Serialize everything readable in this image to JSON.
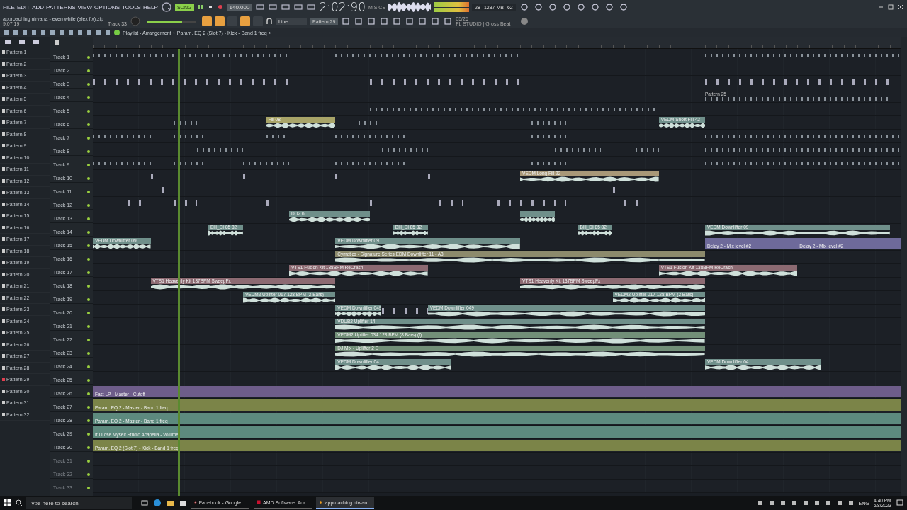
{
  "menu": [
    "FILE",
    "EDIT",
    "ADD",
    "PATTERNS",
    "VIEW",
    "OPTIONS",
    "TOOLS",
    "HELP"
  ],
  "transport": {
    "song_mode": {
      "label": "SONG",
      "on": true
    },
    "tempo": "140.000",
    "time": "2:02:90",
    "time_format": "M:S:CS"
  },
  "stats": {
    "cpu": "28",
    "memory": "1287 MB",
    "polyphony": "62"
  },
  "project": {
    "name": "approaching nirvana - even while (alex fix).zip",
    "duration": "9:07:19",
    "focus": "Track 33",
    "volume": {
      "level": 0.72
    }
  },
  "snap_buttons": [
    {
      "on": true
    },
    {
      "on": true
    },
    {
      "on": false
    },
    {
      "on": true
    },
    {
      "on": false
    }
  ],
  "snap": "Line",
  "pattern_selector": "Pattern 29",
  "news": {
    "date": "05/26",
    "text": "FL STUDIO | Gross Beat"
  },
  "breadcrumb": [
    {
      "text": "Playlist - Arrangement"
    },
    {
      "text": "›"
    },
    {
      "text": "Param. EQ 2 (Slot 7) - Kick - Band 1 freq"
    },
    {
      "text": "›"
    }
  ],
  "patterns": [
    {
      "name": "Pattern 1",
      "selected": false
    },
    {
      "name": "Pattern 2",
      "selected": false
    },
    {
      "name": "Pattern 3",
      "selected": false
    },
    {
      "name": "Pattern 4",
      "selected": false
    },
    {
      "name": "Pattern 5",
      "selected": false
    },
    {
      "name": "Pattern 6",
      "selected": false
    },
    {
      "name": "Pattern 7",
      "selected": false
    },
    {
      "name": "Pattern 8",
      "selected": false
    },
    {
      "name": "Pattern 9",
      "selected": false
    },
    {
      "name": "Pattern 10",
      "selected": false
    },
    {
      "name": "Pattern 11",
      "selected": false
    },
    {
      "name": "Pattern 12",
      "selected": false
    },
    {
      "name": "Pattern 13",
      "selected": false
    },
    {
      "name": "Pattern 14",
      "selected": false
    },
    {
      "name": "Pattern 15",
      "selected": false
    },
    {
      "name": "Pattern 16",
      "selected": false
    },
    {
      "name": "Pattern 17",
      "selected": false
    },
    {
      "name": "Pattern 18",
      "selected": false
    },
    {
      "name": "Pattern 19",
      "selected": false
    },
    {
      "name": "Pattern 20",
      "selected": false
    },
    {
      "name": "Pattern 21",
      "selected": false
    },
    {
      "name": "Pattern 22",
      "selected": false
    },
    {
      "name": "Pattern 23",
      "selected": false
    },
    {
      "name": "Pattern 24",
      "selected": false
    },
    {
      "name": "Pattern 25",
      "selected": false
    },
    {
      "name": "Pattern 26",
      "selected": false
    },
    {
      "name": "Pattern 27",
      "selected": false
    },
    {
      "name": "Pattern 28",
      "selected": false
    },
    {
      "name": "Pattern 29",
      "selected": true
    },
    {
      "name": "Pattern 30",
      "selected": false
    },
    {
      "name": "Pattern 31",
      "selected": false
    },
    {
      "name": "Pattern 32",
      "selected": false
    }
  ],
  "playhead": {
    "level": 0.105
  },
  "tracks": [
    {
      "name": "Track 1",
      "empty": false,
      "clips": [
        {
          "kind": "pattern"
        },
        {
          "kind": "pattern"
        },
        {
          "kind": "pattern"
        }
      ]
    },
    {
      "name": "Track 2",
      "empty": false
    },
    {
      "name": "Track 3",
      "empty": false,
      "clips": [
        {
          "kind": "hits"
        },
        {
          "kind": "hits"
        },
        {
          "kind": "hits"
        }
      ]
    },
    {
      "name": "Track 4",
      "empty": false,
      "clips": [
        {
          "kind": "pattern",
          "label": "Pattern 25"
        }
      ]
    },
    {
      "name": "Track 5",
      "empty": false,
      "clips": [
        {
          "kind": "pattern"
        }
      ]
    },
    {
      "name": "Track 6",
      "empty": false,
      "clips": [
        {
          "kind": "pattern"
        },
        {
          "kind": "audio",
          "label": "Fill 08",
          "color": "#a8a468"
        },
        {
          "kind": "pattern"
        },
        {
          "kind": "pattern"
        },
        {
          "kind": "audio",
          "label": "VEDM Short Fill 42",
          "color": "#6f8f8a"
        }
      ]
    },
    {
      "name": "Track 7",
      "empty": false,
      "clips": [
        {
          "kind": "pattern"
        },
        {
          "kind": "pattern"
        },
        {
          "kind": "pattern"
        },
        {
          "kind": "pattern"
        },
        {
          "kind": "pattern"
        },
        {
          "kind": "pattern"
        }
      ]
    },
    {
      "name": "Track 8",
      "empty": false,
      "clips": [
        {
          "kind": "pattern"
        },
        {
          "kind": "pattern"
        },
        {
          "kind": "pattern"
        },
        {
          "kind": "pattern"
        },
        {
          "kind": "pattern"
        }
      ]
    },
    {
      "name": "Track 9",
      "empty": false,
      "clips": [
        {
          "kind": "pattern"
        },
        {
          "kind": "pattern"
        },
        {
          "kind": "pattern"
        },
        {
          "kind": "pattern"
        },
        {
          "kind": "pattern"
        },
        {
          "kind": "pattern"
        }
      ]
    },
    {
      "name": "Track 10",
      "empty": false,
      "clips": [
        {
          "kind": "hits"
        },
        {
          "kind": "hits"
        },
        {
          "kind": "hits"
        },
        {
          "kind": "hits"
        },
        {
          "kind": "audio",
          "label": "VEDM Long Fill 22",
          "color": "#a89878"
        }
      ]
    },
    {
      "name": "Track 11",
      "empty": false,
      "clips": [
        {
          "kind": "hits"
        },
        {
          "kind": "hits"
        }
      ]
    },
    {
      "name": "Track 12",
      "empty": false,
      "clips": [
        {
          "kind": "hits"
        },
        {
          "kind": "hits"
        },
        {
          "kind": "hits"
        },
        {
          "kind": "hits"
        },
        {
          "kind": "hits"
        },
        {
          "kind": "hits"
        },
        {
          "kind": "hits"
        }
      ]
    },
    {
      "name": "Track 13",
      "empty": false,
      "clips": [
        {
          "kind": "audio",
          "label": "DD2 6",
          "color": "#6f8f8a"
        },
        {
          "kind": "audio",
          "color": "#6f8f8a"
        }
      ]
    },
    {
      "name": "Track 14",
      "empty": false,
      "clips": [
        {
          "kind": "audio",
          "label": "BH_DI 85 82",
          "color": "#6f8f8a"
        },
        {
          "kind": "audio",
          "label": "BH_DI 85 82",
          "color": "#6f8f8a"
        },
        {
          "kind": "audio",
          "label": "BH_DI 85 82",
          "color": "#6f8f8a"
        },
        {
          "kind": "audio",
          "label": "VEDM Downlifter 09",
          "color": "#6f8f8a"
        }
      ]
    },
    {
      "name": "Track 15",
      "empty": false,
      "clips": [
        {
          "kind": "audio",
          "label": "VEDM Downlifter 09",
          "color": "#6f8f8a"
        },
        {
          "kind": "audio",
          "label": "VEDM Downlifter 09",
          "color": "#6f8f8a"
        },
        {
          "kind": "automation",
          "label": "Delay 2 - Mix level #2",
          "color": "#6e6a9a"
        },
        {
          "kind": "automation",
          "label": "Delay 2 - Mix level #2",
          "color": "#6e6a9a"
        }
      ]
    },
    {
      "name": "Track 16",
      "empty": false,
      "clips": [
        {
          "kind": "audio",
          "label": "Cymatics - Signature Series EDM Downlifter 11 - A8",
          "color": "#8c8a6c"
        }
      ]
    },
    {
      "name": "Track 17",
      "empty": false,
      "clips": [
        {
          "kind": "audio",
          "label": "VTS1 Fusion Kit 138BPM ReCrash",
          "color": "#8c6a72"
        },
        {
          "kind": "audio",
          "label": "VTS1 Fusion Kit 138BPM ReCrash",
          "color": "#8c6a72"
        }
      ]
    },
    {
      "name": "Track 18",
      "empty": false,
      "clips": [
        {
          "kind": "audio",
          "label": "VTS1 Heavenly Kit 137BPM SweepFx",
          "color": "#8c6a72"
        },
        {
          "kind": "audio",
          "label": "VTS1 Heavenly Kit 137BPM SweepFx",
          "color": "#8c6a72"
        }
      ]
    },
    {
      "name": "Track 19",
      "empty": false,
      "clips": [
        {
          "kind": "audio",
          "label": "VEDM2 Uplifter 017 128 BPM (2 Bars)",
          "color": "#6f8f8a"
        },
        {
          "kind": "audio",
          "label": "VEDM2 Uplifter 017 128 BPM (2 Bars)",
          "color": "#6f8f8a"
        }
      ]
    },
    {
      "name": "Track 20",
      "empty": false,
      "clips": [
        {
          "kind": "audio",
          "label": "VEDM Downlifter 049",
          "color": "#6f8f8a"
        },
        {
          "kind": "hits"
        },
        {
          "kind": "audio",
          "label": "VEDM Downlifter 049",
          "color": "#6f8f8a"
        }
      ]
    },
    {
      "name": "Track 21",
      "empty": false,
      "clips": [
        {
          "kind": "audio",
          "label": "VDUB2 Uplifter 14",
          "color": "#6f8f8a"
        }
      ]
    },
    {
      "name": "Track 22",
      "empty": false,
      "clips": [
        {
          "kind": "audio",
          "label": "VEDM2 Uplifter 034 128 BPM (8 Bars) (f)",
          "color": "#728f78"
        }
      ]
    },
    {
      "name": "Track 23",
      "empty": false,
      "clips": [
        {
          "kind": "audio",
          "label": "DJ Mix - Uplifter 2 E",
          "color": "#728f78"
        }
      ]
    },
    {
      "name": "Track 24",
      "empty": false,
      "clips": [
        {
          "kind": "audio",
          "label": "VEDM Downlifter 04",
          "color": "#6f8f8a"
        },
        {
          "kind": "audio",
          "label": "VEDM Downlifter 04",
          "color": "#6f8f8a"
        }
      ]
    },
    {
      "name": "Track 25",
      "empty": false
    },
    {
      "name": "Track 26",
      "empty": false,
      "clips": [
        {
          "kind": "automation",
          "label": "Fast LP - Master - Cutoff",
          "color": "#6e5d8a"
        }
      ]
    },
    {
      "name": "Track 27",
      "empty": false,
      "clips": [
        {
          "kind": "automation",
          "label": "Param. EQ 2 - Master - Band 1 freq",
          "color": "#7b8448"
        }
      ]
    },
    {
      "name": "Track 28",
      "empty": false,
      "clips": [
        {
          "kind": "automation",
          "label": "Param. EQ 2 - Master - Band 1 freq",
          "color": "#5d8a7e"
        }
      ]
    },
    {
      "name": "Track 29",
      "empty": false,
      "clips": [
        {
          "kind": "automation",
          "label": "If I Lose Myself Studio Acapella - Volume",
          "color": "#5d8a7e"
        }
      ]
    },
    {
      "name": "Track 30",
      "empty": false,
      "clips": [
        {
          "kind": "automation",
          "label": "Param. EQ 2 (Slot 7) - Kick - Band 1 freq",
          "color": "#7b8448"
        }
      ]
    },
    {
      "name": "Track 31",
      "empty": true
    },
    {
      "name": "Track 32",
      "empty": true
    },
    {
      "name": "Track 33",
      "empty": true
    }
  ],
  "taskbar": {
    "search": {
      "placeholder": "Type here to search"
    },
    "apps": [
      {
        "kind": "chrome",
        "label": "Facebook - Google ...",
        "active": false
      },
      {
        "kind": "amd",
        "label": "AMD Software: Adr...",
        "active": false
      },
      {
        "kind": "fl",
        "label": "approaching nirvan...",
        "active": true
      }
    ],
    "language": "ENG",
    "time": "4:40 PM",
    "date": "6/8/2023"
  }
}
